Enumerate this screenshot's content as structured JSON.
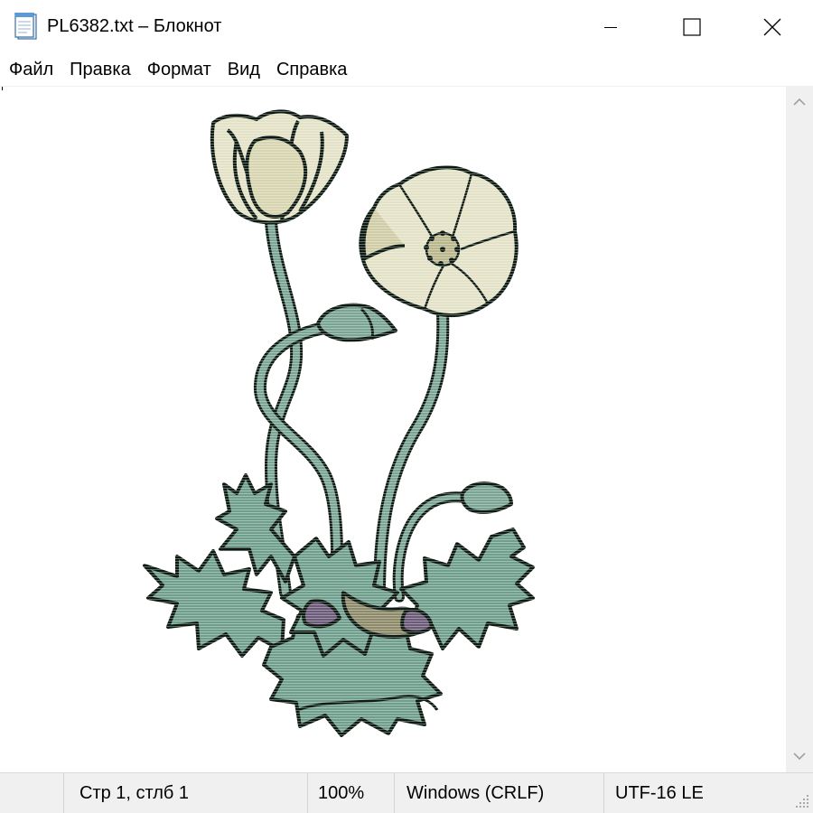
{
  "window": {
    "title": "PL6382.txt – Блокнот",
    "icon": "notepad-icon",
    "controls": [
      "minimize-icon",
      "maximize-icon",
      "close-icon"
    ]
  },
  "menu": {
    "items": [
      "Файл",
      "Правка",
      "Формат",
      "Вид",
      "Справка"
    ]
  },
  "editor": {
    "content": "ASCII-art illustration of poppy flowers with leaves"
  },
  "status": {
    "position": "Стр 1, стлб 1",
    "zoom": "100%",
    "line_endings": "Windows (CRLF)",
    "encoding": "UTF-16 LE"
  },
  "colors": {
    "outline": "#0d1a12",
    "stem": "#7aa595",
    "leaf": "#6f9e8c",
    "petal": "#e3e1c6",
    "petal_shade": "#c9c69c",
    "shadow": "#8d8a6a",
    "purple": "#6b5a78"
  }
}
